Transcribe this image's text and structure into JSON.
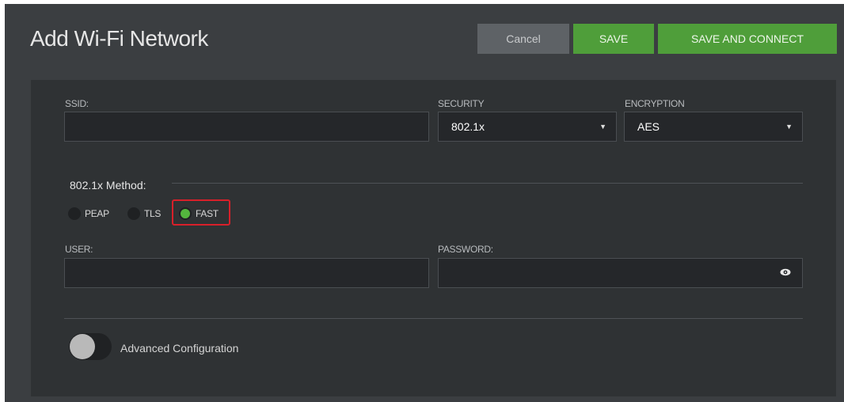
{
  "dialog": {
    "title": "Add Wi-Fi Network",
    "buttons": {
      "cancel": "Cancel",
      "save": "SAVE",
      "save_connect": "SAVE AND CONNECT"
    }
  },
  "form": {
    "ssid": {
      "label": "SSID:",
      "value": ""
    },
    "security": {
      "label": "SECURITY",
      "value": "802.1x"
    },
    "encryption": {
      "label": "ENCRYPTION",
      "value": "AES"
    },
    "method": {
      "title": "802.1x Method:",
      "options": [
        {
          "label": "PEAP",
          "selected": false
        },
        {
          "label": "TLS",
          "selected": false
        },
        {
          "label": "FAST",
          "selected": true
        }
      ]
    },
    "user": {
      "label": "USER:",
      "value": ""
    },
    "password": {
      "label": "PASSWORD:",
      "value": ""
    },
    "advanced": {
      "label": "Advanced Configuration",
      "enabled": false
    }
  },
  "colors": {
    "accent_green": "#4f9e3a",
    "radio_selected": "#54b63e",
    "highlight_red": "#d8202a"
  },
  "icons": {
    "select_arrow": "caret-down-icon",
    "password_toggle": "eye-icon"
  }
}
